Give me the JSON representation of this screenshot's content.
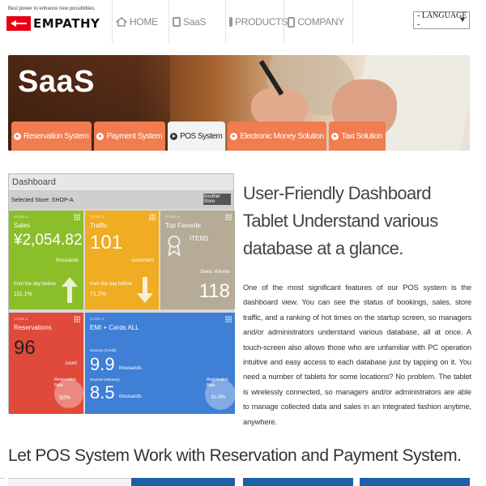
{
  "header": {
    "tagline": "Best power to enhance new possibilities.",
    "logo_text": "EMPATHY",
    "nav": [
      {
        "label": "HOME",
        "icon": "home-icon"
      },
      {
        "label": "SaaS",
        "icon": "document-icon"
      },
      {
        "label": "PRODUCTS",
        "icon": "box-icon"
      },
      {
        "label": "COMPANY",
        "icon": "tablet-icon"
      }
    ],
    "language_select": "- LANGUAGE -"
  },
  "hero": {
    "title": "SaaS",
    "tabs": [
      {
        "label": "Reservation System",
        "active": false
      },
      {
        "label": "Payment System",
        "active": false
      },
      {
        "label": "POS System",
        "active": true
      },
      {
        "label": "Electronic Money Solution",
        "active": false
      },
      {
        "label": "Taxi Solution",
        "active": false
      }
    ]
  },
  "dashboard": {
    "header": "Dashboard",
    "selected_store": "Selected Store: SHOP-A",
    "another_store": "Another Store",
    "tiles": {
      "sales": {
        "tag": "STORE A",
        "title": "Sales",
        "value": "¥2,054.82",
        "unit": "thousands",
        "compare": "from the day before",
        "compare_value": "111.1%"
      },
      "traffic": {
        "tag": "STORE A",
        "title": "Traffic",
        "value": "101",
        "unit": "customers",
        "compare": "from the day before",
        "compare_value": "71.2%"
      },
      "top": {
        "tag": "STORE A",
        "title": "Top Favorite",
        "item": "ITEM1",
        "volume_label": "Sales Volume",
        "volume": "118"
      },
      "reservations": {
        "tag": "STORE A",
        "title": "Reservations",
        "value": "96",
        "unit": "count",
        "rate_label": "Reservation Rate",
        "rate": "50%"
      },
      "emi": {
        "tag": "STORE A",
        "title": "EMI + Cards ALL",
        "v1_label": "Sources (Credit)",
        "v1": "9.9",
        "v1_unit": "thousands",
        "v2_label": "Sources (eMoney)",
        "v2": "8.5",
        "v2_unit": "thousands",
        "rate_label": "Registration Rate",
        "rate": "81.9%"
      }
    }
  },
  "feature": {
    "title": "User-Friendly Dashboard Tablet Understand various database at a glance.",
    "body": "One of the most significant features of our POS system is the dashboard view. You can see the status of bookings, sales, store traffic, and a ranking of hot times on the startup screen, so managers and/or administrators understand various database, all at once. A touch-screen also allows those who are unfamiliar with PC operation intuitive and easy access to each database just by tapping on it. You need a number of tablets for some locations? No problem. The tablet is wirelessly connected, so managers and/or administrators are able to manage collected data and sales in an integrated fashion anytime, anywhere."
  },
  "section2": {
    "title": "Let POS System Work with Reservation and Payment System."
  },
  "colors": {
    "accent_orange": "#f07c4f",
    "brand_red": "#e60012",
    "sales_green": "#8bbf2a",
    "traffic_orange": "#f0ac23",
    "reservation_red": "#e04a3a",
    "emi_blue": "#3f7fd6",
    "button_blue": "#1e5fa8"
  }
}
